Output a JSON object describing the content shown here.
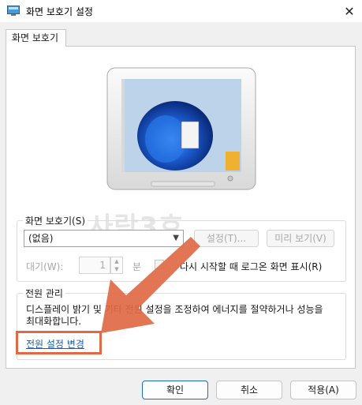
{
  "window": {
    "title": "화면 보호기 설정",
    "close_glyph": "✕"
  },
  "tab": {
    "label": "화면 보호기"
  },
  "screensaver": {
    "group_label": "화면 보호기(S)",
    "selected": "(없음)",
    "settings_button": "설정(T)...",
    "preview_button": "미리 보기(V)",
    "wait_label": "대기(W):",
    "wait_value": "1",
    "wait_unit": "분",
    "resume_label": "다시 시작할 때 로그온 화면 표시(R)"
  },
  "power": {
    "group_label": "전원 관리",
    "description": "디스플레이 밝기 및 기타 전원 설정을 조정하여 에너지를 절약하거나 성능을 최대화합니다.",
    "link": "전원 설정 변경"
  },
  "watermark": "사람3호",
  "buttons": {
    "ok": "확인",
    "cancel": "취소",
    "apply": "적용(A)"
  },
  "colors": {
    "annotation": "#e06a45",
    "link": "#1a5fb4",
    "accent": "#1f6fb7"
  }
}
